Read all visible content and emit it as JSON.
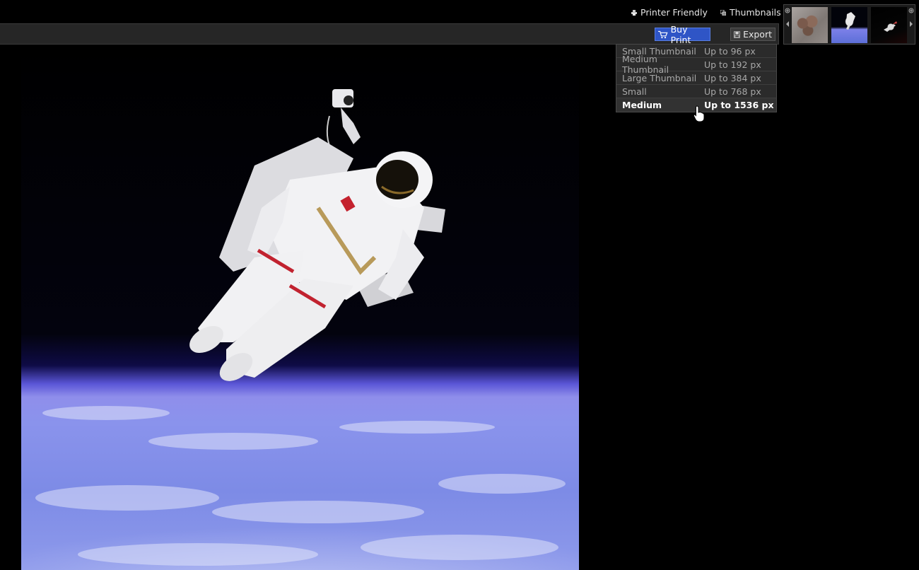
{
  "header": {
    "printer_friendly": "Printer Friendly",
    "thumbnails": "Thumbnails"
  },
  "toolbar": {
    "buy_print": "Buy Print",
    "export": "Export"
  },
  "size_menu": {
    "items": [
      {
        "name": "Small Thumbnail",
        "size": "Up to 96 px"
      },
      {
        "name": "Medium Thumbnail",
        "size": "Up to 192 px"
      },
      {
        "name": "Large Thumbnail",
        "size": "Up to 384 px"
      },
      {
        "name": "Small",
        "size": "Up to 768 px"
      },
      {
        "name": "Medium",
        "size": "Up to 1536 px"
      }
    ],
    "selected": "Medium"
  },
  "filmstrip": {
    "thumbs": [
      "moon-surface-thumbnail",
      "astronaut-thumbnail",
      "space-shuttle-thumbnail"
    ]
  },
  "icons": {
    "printer": "printer-icon",
    "thumbnails": "thumbnails-icon",
    "cart": "cart-icon",
    "floppy": "floppy-icon"
  },
  "colors": {
    "buy_print_bg": "#2f55c6",
    "toolbar_bg": "#262626",
    "menu_bg": "#2b2b2b"
  }
}
